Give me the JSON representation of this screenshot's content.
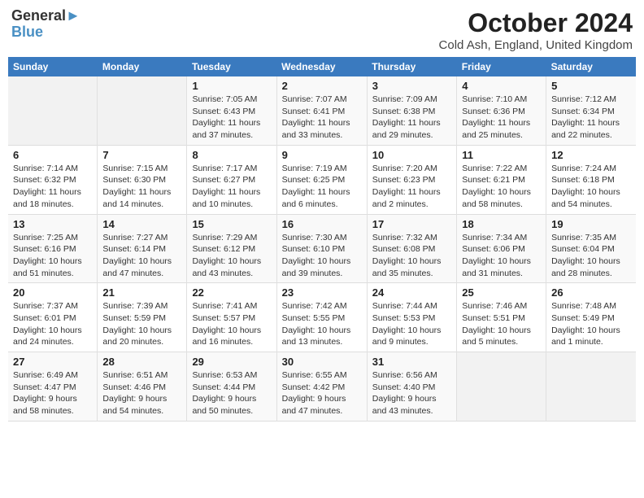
{
  "logo": {
    "line1": "General",
    "line2": "Blue"
  },
  "title": "October 2024",
  "subtitle": "Cold Ash, England, United Kingdom",
  "days_of_week": [
    "Sunday",
    "Monday",
    "Tuesday",
    "Wednesday",
    "Thursday",
    "Friday",
    "Saturday"
  ],
  "weeks": [
    [
      {
        "day": null
      },
      {
        "day": null
      },
      {
        "day": "1",
        "detail": "Sunrise: 7:05 AM\nSunset: 6:43 PM\nDaylight: 11 hours and 37 minutes."
      },
      {
        "day": "2",
        "detail": "Sunrise: 7:07 AM\nSunset: 6:41 PM\nDaylight: 11 hours and 33 minutes."
      },
      {
        "day": "3",
        "detail": "Sunrise: 7:09 AM\nSunset: 6:38 PM\nDaylight: 11 hours and 29 minutes."
      },
      {
        "day": "4",
        "detail": "Sunrise: 7:10 AM\nSunset: 6:36 PM\nDaylight: 11 hours and 25 minutes."
      },
      {
        "day": "5",
        "detail": "Sunrise: 7:12 AM\nSunset: 6:34 PM\nDaylight: 11 hours and 22 minutes."
      }
    ],
    [
      {
        "day": "6",
        "detail": "Sunrise: 7:14 AM\nSunset: 6:32 PM\nDaylight: 11 hours and 18 minutes."
      },
      {
        "day": "7",
        "detail": "Sunrise: 7:15 AM\nSunset: 6:30 PM\nDaylight: 11 hours and 14 minutes."
      },
      {
        "day": "8",
        "detail": "Sunrise: 7:17 AM\nSunset: 6:27 PM\nDaylight: 11 hours and 10 minutes."
      },
      {
        "day": "9",
        "detail": "Sunrise: 7:19 AM\nSunset: 6:25 PM\nDaylight: 11 hours and 6 minutes."
      },
      {
        "day": "10",
        "detail": "Sunrise: 7:20 AM\nSunset: 6:23 PM\nDaylight: 11 hours and 2 minutes."
      },
      {
        "day": "11",
        "detail": "Sunrise: 7:22 AM\nSunset: 6:21 PM\nDaylight: 10 hours and 58 minutes."
      },
      {
        "day": "12",
        "detail": "Sunrise: 7:24 AM\nSunset: 6:18 PM\nDaylight: 10 hours and 54 minutes."
      }
    ],
    [
      {
        "day": "13",
        "detail": "Sunrise: 7:25 AM\nSunset: 6:16 PM\nDaylight: 10 hours and 51 minutes."
      },
      {
        "day": "14",
        "detail": "Sunrise: 7:27 AM\nSunset: 6:14 PM\nDaylight: 10 hours and 47 minutes."
      },
      {
        "day": "15",
        "detail": "Sunrise: 7:29 AM\nSunset: 6:12 PM\nDaylight: 10 hours and 43 minutes."
      },
      {
        "day": "16",
        "detail": "Sunrise: 7:30 AM\nSunset: 6:10 PM\nDaylight: 10 hours and 39 minutes."
      },
      {
        "day": "17",
        "detail": "Sunrise: 7:32 AM\nSunset: 6:08 PM\nDaylight: 10 hours and 35 minutes."
      },
      {
        "day": "18",
        "detail": "Sunrise: 7:34 AM\nSunset: 6:06 PM\nDaylight: 10 hours and 31 minutes."
      },
      {
        "day": "19",
        "detail": "Sunrise: 7:35 AM\nSunset: 6:04 PM\nDaylight: 10 hours and 28 minutes."
      }
    ],
    [
      {
        "day": "20",
        "detail": "Sunrise: 7:37 AM\nSunset: 6:01 PM\nDaylight: 10 hours and 24 minutes."
      },
      {
        "day": "21",
        "detail": "Sunrise: 7:39 AM\nSunset: 5:59 PM\nDaylight: 10 hours and 20 minutes."
      },
      {
        "day": "22",
        "detail": "Sunrise: 7:41 AM\nSunset: 5:57 PM\nDaylight: 10 hours and 16 minutes."
      },
      {
        "day": "23",
        "detail": "Sunrise: 7:42 AM\nSunset: 5:55 PM\nDaylight: 10 hours and 13 minutes."
      },
      {
        "day": "24",
        "detail": "Sunrise: 7:44 AM\nSunset: 5:53 PM\nDaylight: 10 hours and 9 minutes."
      },
      {
        "day": "25",
        "detail": "Sunrise: 7:46 AM\nSunset: 5:51 PM\nDaylight: 10 hours and 5 minutes."
      },
      {
        "day": "26",
        "detail": "Sunrise: 7:48 AM\nSunset: 5:49 PM\nDaylight: 10 hours and 1 minute."
      }
    ],
    [
      {
        "day": "27",
        "detail": "Sunrise: 6:49 AM\nSunset: 4:47 PM\nDaylight: 9 hours and 58 minutes."
      },
      {
        "day": "28",
        "detail": "Sunrise: 6:51 AM\nSunset: 4:46 PM\nDaylight: 9 hours and 54 minutes."
      },
      {
        "day": "29",
        "detail": "Sunrise: 6:53 AM\nSunset: 4:44 PM\nDaylight: 9 hours and 50 minutes."
      },
      {
        "day": "30",
        "detail": "Sunrise: 6:55 AM\nSunset: 4:42 PM\nDaylight: 9 hours and 47 minutes."
      },
      {
        "day": "31",
        "detail": "Sunrise: 6:56 AM\nSunset: 4:40 PM\nDaylight: 9 hours and 43 minutes."
      },
      {
        "day": null
      },
      {
        "day": null
      }
    ]
  ]
}
